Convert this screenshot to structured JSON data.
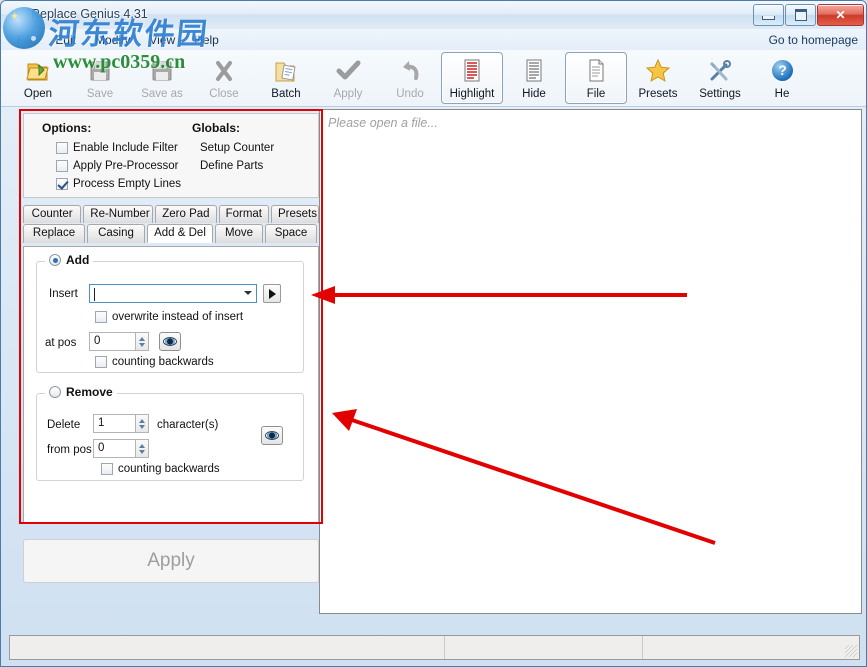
{
  "window": {
    "title": "Replace Genius 4.31",
    "buttons": {
      "minimize": "minimize-button",
      "maximize": "maximize-button",
      "close": "close-button"
    }
  },
  "menubar": {
    "items": [
      "File",
      "Edit",
      "Modify",
      "View",
      "Help"
    ],
    "homepage_link": "Go to homepage"
  },
  "toolbar": {
    "buttons": [
      {
        "label": "Open",
        "icon": "open-folder-icon",
        "enabled": true,
        "pressed": false
      },
      {
        "label": "Save",
        "icon": "save-disk-icon",
        "enabled": false,
        "pressed": false
      },
      {
        "label": "Save as",
        "icon": "save-as-disk-icon",
        "enabled": false,
        "pressed": false
      },
      {
        "label": "Close",
        "icon": "close-x-icon",
        "enabled": false,
        "pressed": false
      },
      {
        "label": "Batch",
        "icon": "batch-folder-icon",
        "enabled": true,
        "pressed": false
      },
      {
        "label": "Apply",
        "icon": "check-icon",
        "enabled": false,
        "pressed": false
      },
      {
        "label": "Undo",
        "icon": "undo-arrow-icon",
        "enabled": false,
        "pressed": false
      },
      {
        "label": "Highlight",
        "icon": "highlight-doc-icon",
        "enabled": true,
        "pressed": true
      },
      {
        "label": "Hide",
        "icon": "hide-doc-icon",
        "enabled": true,
        "pressed": false
      },
      {
        "label": "File",
        "icon": "file-page-icon",
        "enabled": true,
        "pressed": true
      },
      {
        "label": "Presets",
        "icon": "star-icon",
        "enabled": true,
        "pressed": false
      },
      {
        "label": "Settings",
        "icon": "tools-icon",
        "enabled": true,
        "pressed": false
      },
      {
        "label": "He",
        "icon": "help-circle-icon",
        "enabled": true,
        "pressed": false
      }
    ]
  },
  "options_panel": {
    "options_title": "Options:",
    "globals_title": "Globals:",
    "checkboxes": [
      {
        "label": "Enable Include Filter",
        "checked": false
      },
      {
        "label": "Apply Pre-Processor",
        "checked": false
      },
      {
        "label": "Process Empty Lines",
        "checked": true
      }
    ],
    "globals": [
      "Setup Counter",
      "Define Parts"
    ]
  },
  "tabs": {
    "row1": [
      "Counter",
      "Re-Number",
      "Zero Pad",
      "Format",
      "Presets"
    ],
    "row2": [
      "Replace",
      "Casing",
      "Add & Del",
      "Move",
      "Space"
    ],
    "active": "Add & Del"
  },
  "add_group": {
    "title": "Add",
    "selected": true,
    "insert_label": "Insert",
    "insert_value": "",
    "insert_placeholder": "",
    "go_button": "insert-apply-button",
    "overwrite_label": "overwrite instead of insert",
    "overwrite_checked": false,
    "at_pos_label": "at pos",
    "at_pos_value": "0",
    "preview_button": "preview-eye-button",
    "counting_backwards_label": "counting backwards",
    "counting_backwards_checked": false
  },
  "remove_group": {
    "title": "Remove",
    "selected": false,
    "delete_label": "Delete",
    "delete_value": "1",
    "characters_label": "character(s)",
    "from_pos_label": "from pos",
    "from_pos_value": "0",
    "preview_button": "preview-eye-button",
    "counting_backwards_label": "counting backwards",
    "counting_backwards_checked": false
  },
  "apply_button": {
    "label": "Apply",
    "enabled": false
  },
  "preview_pane": {
    "placeholder": "Please open a file..."
  },
  "statusbar": {
    "cells": [
      "",
      "",
      ""
    ]
  },
  "watermark": {
    "chinese": "河东软件园",
    "url": "www.pc0359.cn"
  },
  "colors": {
    "annotation": "#e20000",
    "accent": "#2f6fb5",
    "title_text": "#28425e",
    "watermark_blue": "#2f7fd0",
    "watermark_green": "#1f8a2f"
  }
}
